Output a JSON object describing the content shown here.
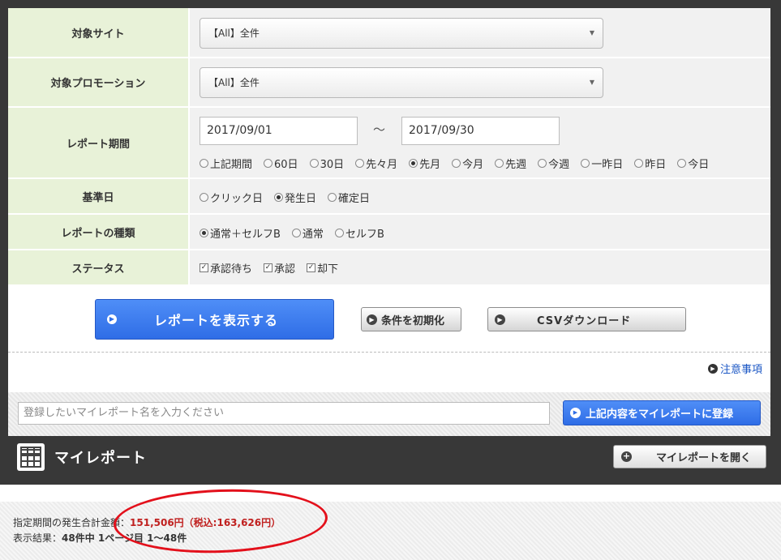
{
  "form": {
    "site": {
      "label": "対象サイト",
      "selected": "【All】全件"
    },
    "promotion": {
      "label": "対象プロモーション",
      "selected": "【All】全件"
    },
    "period": {
      "label": "レポート期間",
      "from": "2017/09/01",
      "separator": "～",
      "to": "2017/09/30",
      "options": [
        "上記期間",
        "60日",
        "30日",
        "先々月",
        "先月",
        "今月",
        "先週",
        "今週",
        "一昨日",
        "昨日",
        "今日"
      ],
      "selected": "先月"
    },
    "base_date": {
      "label": "基準日",
      "options": [
        "クリック日",
        "発生日",
        "確定日"
      ],
      "selected": "発生日"
    },
    "report_type": {
      "label": "レポートの種類",
      "options": [
        "通常＋セルフB",
        "通常",
        "セルフB"
      ],
      "selected": "通常＋セルフB"
    },
    "status": {
      "label": "ステータス",
      "options": [
        "承認待ち",
        "承認",
        "却下"
      ],
      "checked": [
        "承認待ち",
        "承認",
        "却下"
      ]
    }
  },
  "buttons": {
    "show_report": "レポートを表示する",
    "reset": "条件を初期化",
    "csv": "CSVダウンロード",
    "notes": "注意事項"
  },
  "myreport_register": {
    "placeholder": "登録したいマイレポート名を入力ください",
    "button": "上記内容をマイレポートに登録"
  },
  "myreport": {
    "title": "マイレポート",
    "open_button": "マイレポートを開く"
  },
  "summary": {
    "amount_label": "指定期間の発生合計金額：",
    "amount": "151,506円（税込:163,626円）",
    "result_label": "表示結果：",
    "result": "48件中 1ページ目 1～48件"
  },
  "colors": {
    "label_bg": "#e8f2d8",
    "primary_button": "#3a79ee",
    "frame": "#383838",
    "amount": "#c0201f",
    "highlight_circle": "#e3101b"
  }
}
